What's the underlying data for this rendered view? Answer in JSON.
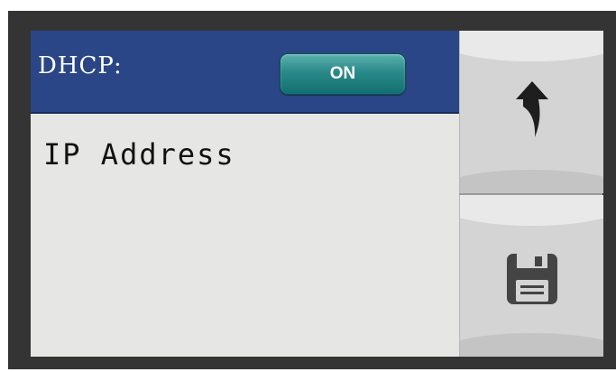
{
  "header": {
    "dhcp_label": "DHCP:",
    "dhcp_toggle": "ON"
  },
  "content": {
    "ip_label": "IP Address"
  },
  "buttons": {
    "back_icon": "undo-arrow-icon",
    "save_icon": "floppy-disk-icon"
  },
  "colors": {
    "header": "#2a4686",
    "toggle": "#2a8a89",
    "panel": "#e6e7e4",
    "button": "#d4d4d4"
  }
}
